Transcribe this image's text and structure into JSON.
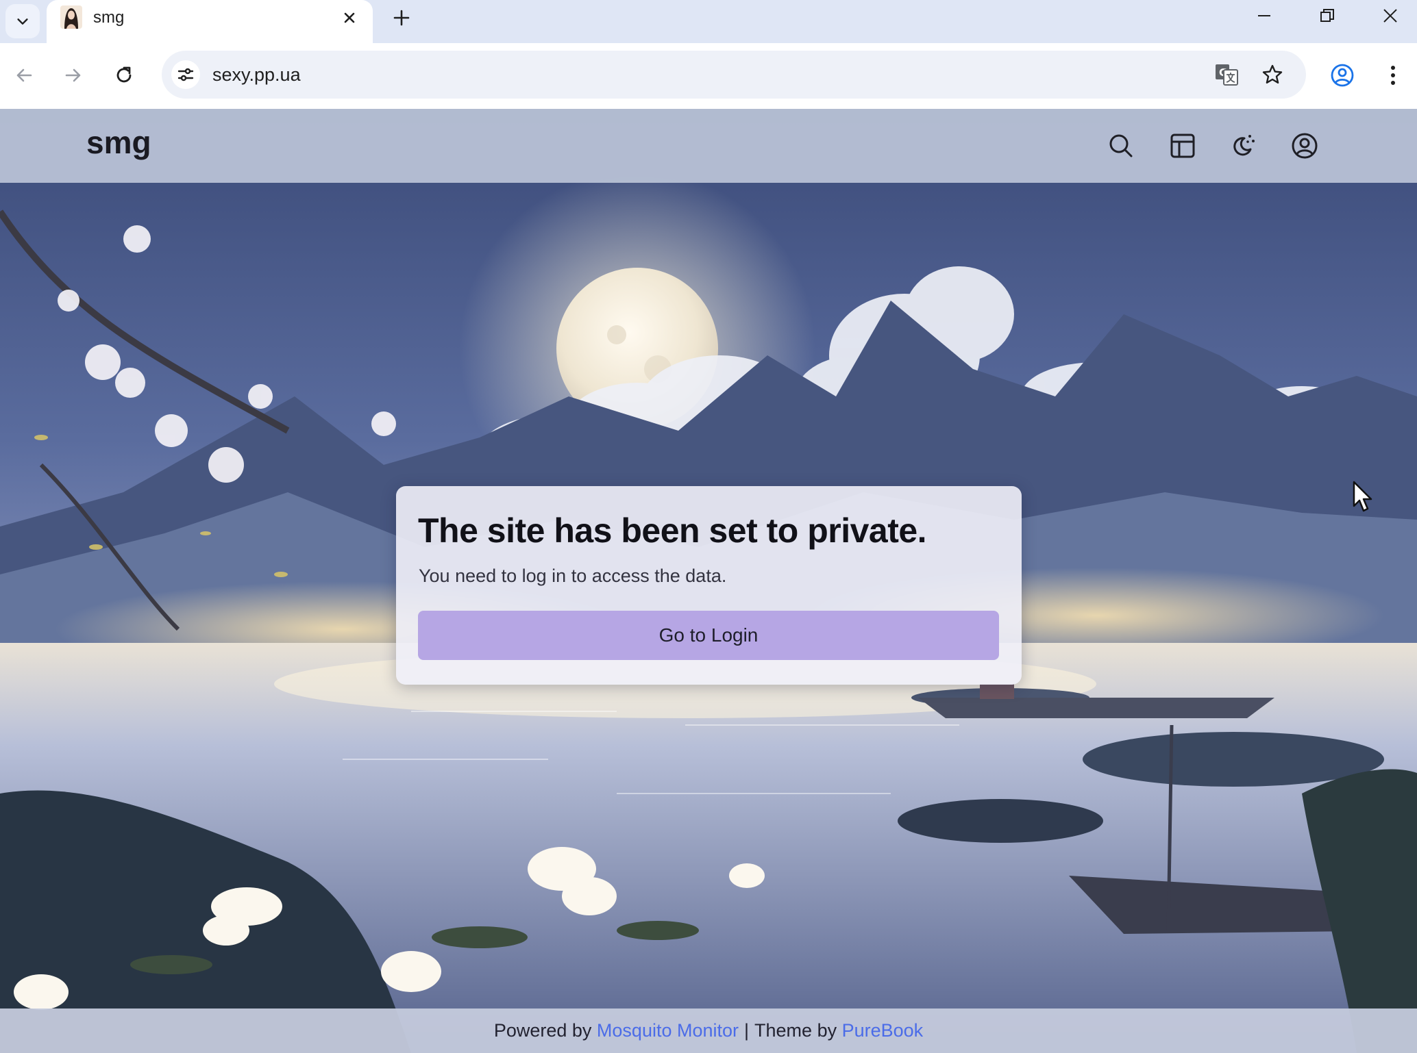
{
  "browser": {
    "tab": {
      "title": "smg"
    },
    "address": {
      "url": "sexy.pp.ua"
    },
    "icons": {
      "tab_search": "chevron-down-icon",
      "close_tab": "close-icon",
      "new_tab": "plus-icon",
      "back": "arrow-left-icon",
      "forward": "arrow-right-icon",
      "reload": "reload-icon",
      "site_info": "tune-icon",
      "translate": "translate-icon",
      "bookmark": "star-icon",
      "profile": "profile-icon",
      "menu": "more-vert-icon"
    }
  },
  "site": {
    "logo": "smg",
    "header_icons": [
      "search-icon",
      "layout-icon",
      "theme-icon",
      "account-icon"
    ]
  },
  "card": {
    "title": "The site has been set to private.",
    "message": "You need to log in to access the data.",
    "button": "Go to Login"
  },
  "footer": {
    "powered_by": "Powered by",
    "powered_link": "Mosquito Monitor",
    "separator": "|",
    "theme_by": "Theme by",
    "theme_link": "PureBook"
  },
  "colors": {
    "accent_button": "#b6a6e4",
    "link": "#4b6ce8",
    "tabstrip": "#dfe6f5"
  }
}
